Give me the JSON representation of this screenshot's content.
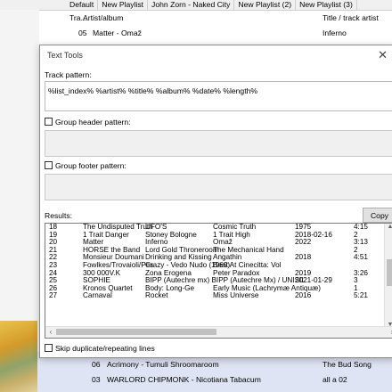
{
  "playlist": {
    "tabs": [
      "Default",
      "New Playlist",
      "John Zorn - Naked City",
      "New Playlist (2)",
      "New Playlist (3)"
    ],
    "header": {
      "col1": "Tra...",
      "col2": "Artist/album",
      "col3": "Title / track artist"
    },
    "rows_top": [
      {
        "num": "05",
        "text": "Matter - Omaž",
        "album": "Inferno"
      }
    ],
    "rows_bottom": [
      {
        "num": "06",
        "text": "Acrimony - Tumuli Shroomaroom",
        "album": "The Bud Song"
      },
      {
        "num": "03",
        "text": "WARLORD CHIPMONK - Nicotiana Tabacum",
        "album": "all a 02"
      }
    ]
  },
  "dialog": {
    "title": "Text Tools",
    "track_pattern_label": "Track pattern:",
    "track_pattern_value": "%list_index%        %artist% %title%   %album%              %date%  %length%",
    "group_header_label": "Group header pattern:",
    "group_footer_label": "Group footer pattern:",
    "results_label": "Results:",
    "copy_label": "Copy",
    "skip_label": "Skip duplicate/repeating lines",
    "results": [
      [
        "18",
        "The Undisputed Truth",
        "UFO'S",
        "Cosmic Truth",
        "1975",
        "4:15"
      ],
      [
        "19",
        "1 Trait Danger",
        "Stoney Bologne",
        "1 Trait High",
        "2018-02-16",
        "2"
      ],
      [
        "20",
        "Matter",
        "Inferno",
        "Omaž",
        "2022",
        "3:13"
      ],
      [
        "21",
        "HORSE the Band",
        "Lord Gold Throneroom",
        "The Mechanical Hand",
        "",
        "2"
      ],
      [
        "22",
        "Monsieur Doumani",
        "Drinking and Kissing",
        "Angathin",
        "2018",
        "4:51"
      ],
      [
        "23",
        "Fowlkes/Trovaioli/Pes",
        "Crazy - Vedo Nudo (1969)",
        "Beat At Cinecitta: Vol",
        "",
        ""
      ],
      [
        "24",
        "300 000V.K",
        "Zona Erogena",
        "Peter Paradox",
        "2019",
        "3:26"
      ],
      [
        "25",
        "SOPHIE",
        "BIPP (Autechre mx) BIPP (Autechre Mx) / UNISIL",
        "",
        "2021-01-29",
        "3"
      ],
      [
        "26",
        "Kronos Quartet",
        "Body: Long-Ge",
        "Early Music (Lachrymæ Antiquæ)",
        "",
        "1"
      ],
      [
        "27",
        "Carnaval",
        "Rocket",
        "Miss Universe",
        "2016",
        "5:21"
      ]
    ]
  }
}
